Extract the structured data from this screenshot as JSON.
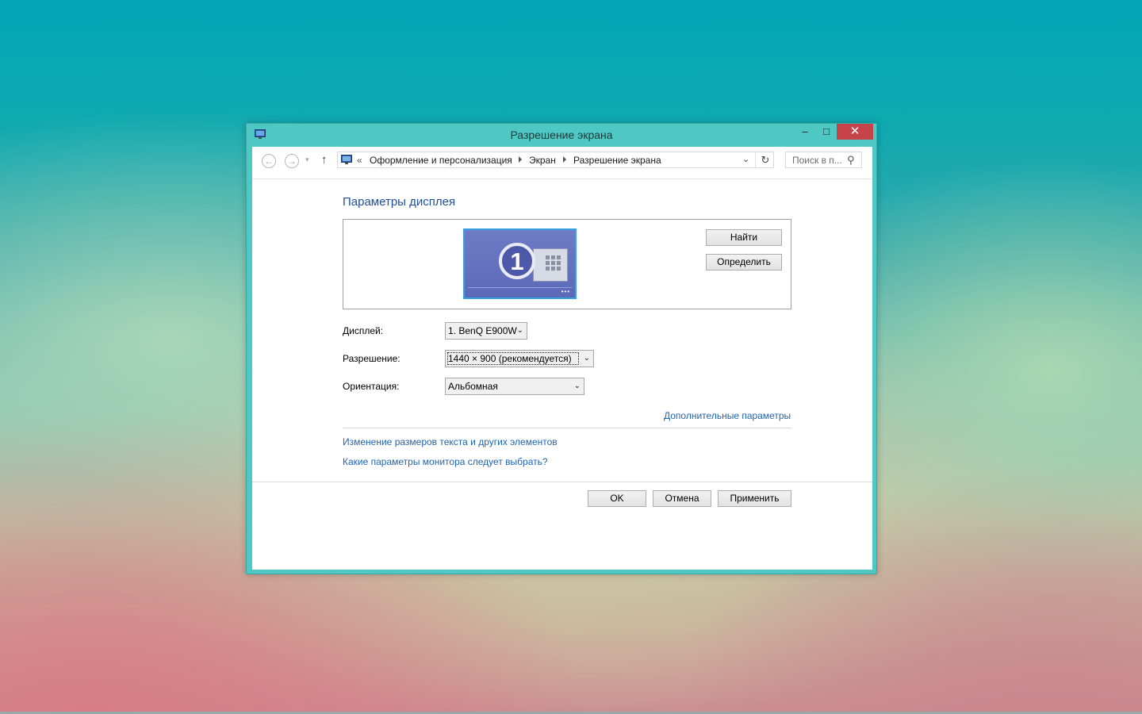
{
  "window": {
    "title": "Разрешение экрана",
    "minimize_glyph": "–",
    "maximize_glyph": "□",
    "close_glyph": "✕"
  },
  "nav": {
    "back_glyph": "←",
    "forward_glyph": "→",
    "recent_glyph": "▾",
    "up_glyph": "↑",
    "overflow_glyph": "«",
    "breadcrumbs": [
      "Оформление и персонализация",
      "Экран",
      "Разрешение экрана"
    ],
    "dropdown_glyph": "⌄",
    "refresh_glyph": "↻",
    "search_placeholder": "Поиск в п...",
    "search_glyph": "⚲"
  },
  "main": {
    "section_title": "Параметры дисплея",
    "monitor_number": "1",
    "monitor_dots": "•••",
    "find_button": "Найти",
    "identify_button": "Определить",
    "fields": {
      "display_label": "Дисплей:",
      "display_value": "1. BenQ E900W",
      "resolution_label": "Разрешение:",
      "resolution_value": "1440 × 900 (рекомендуется)",
      "orientation_label": "Ориентация:",
      "orientation_value": "Альбомная"
    },
    "advanced_link": "Дополнительные параметры",
    "links": [
      "Изменение размеров текста и других элементов",
      "Какие параметры монитора следует выбрать?"
    ]
  },
  "footer": {
    "ok": "OK",
    "cancel": "Отмена",
    "apply": "Применить"
  },
  "colors": {
    "link": "#1e64b4",
    "title_blue": "#1e4e9a",
    "window_frame": "#4fc8c4",
    "close_button": "#c7434a"
  }
}
